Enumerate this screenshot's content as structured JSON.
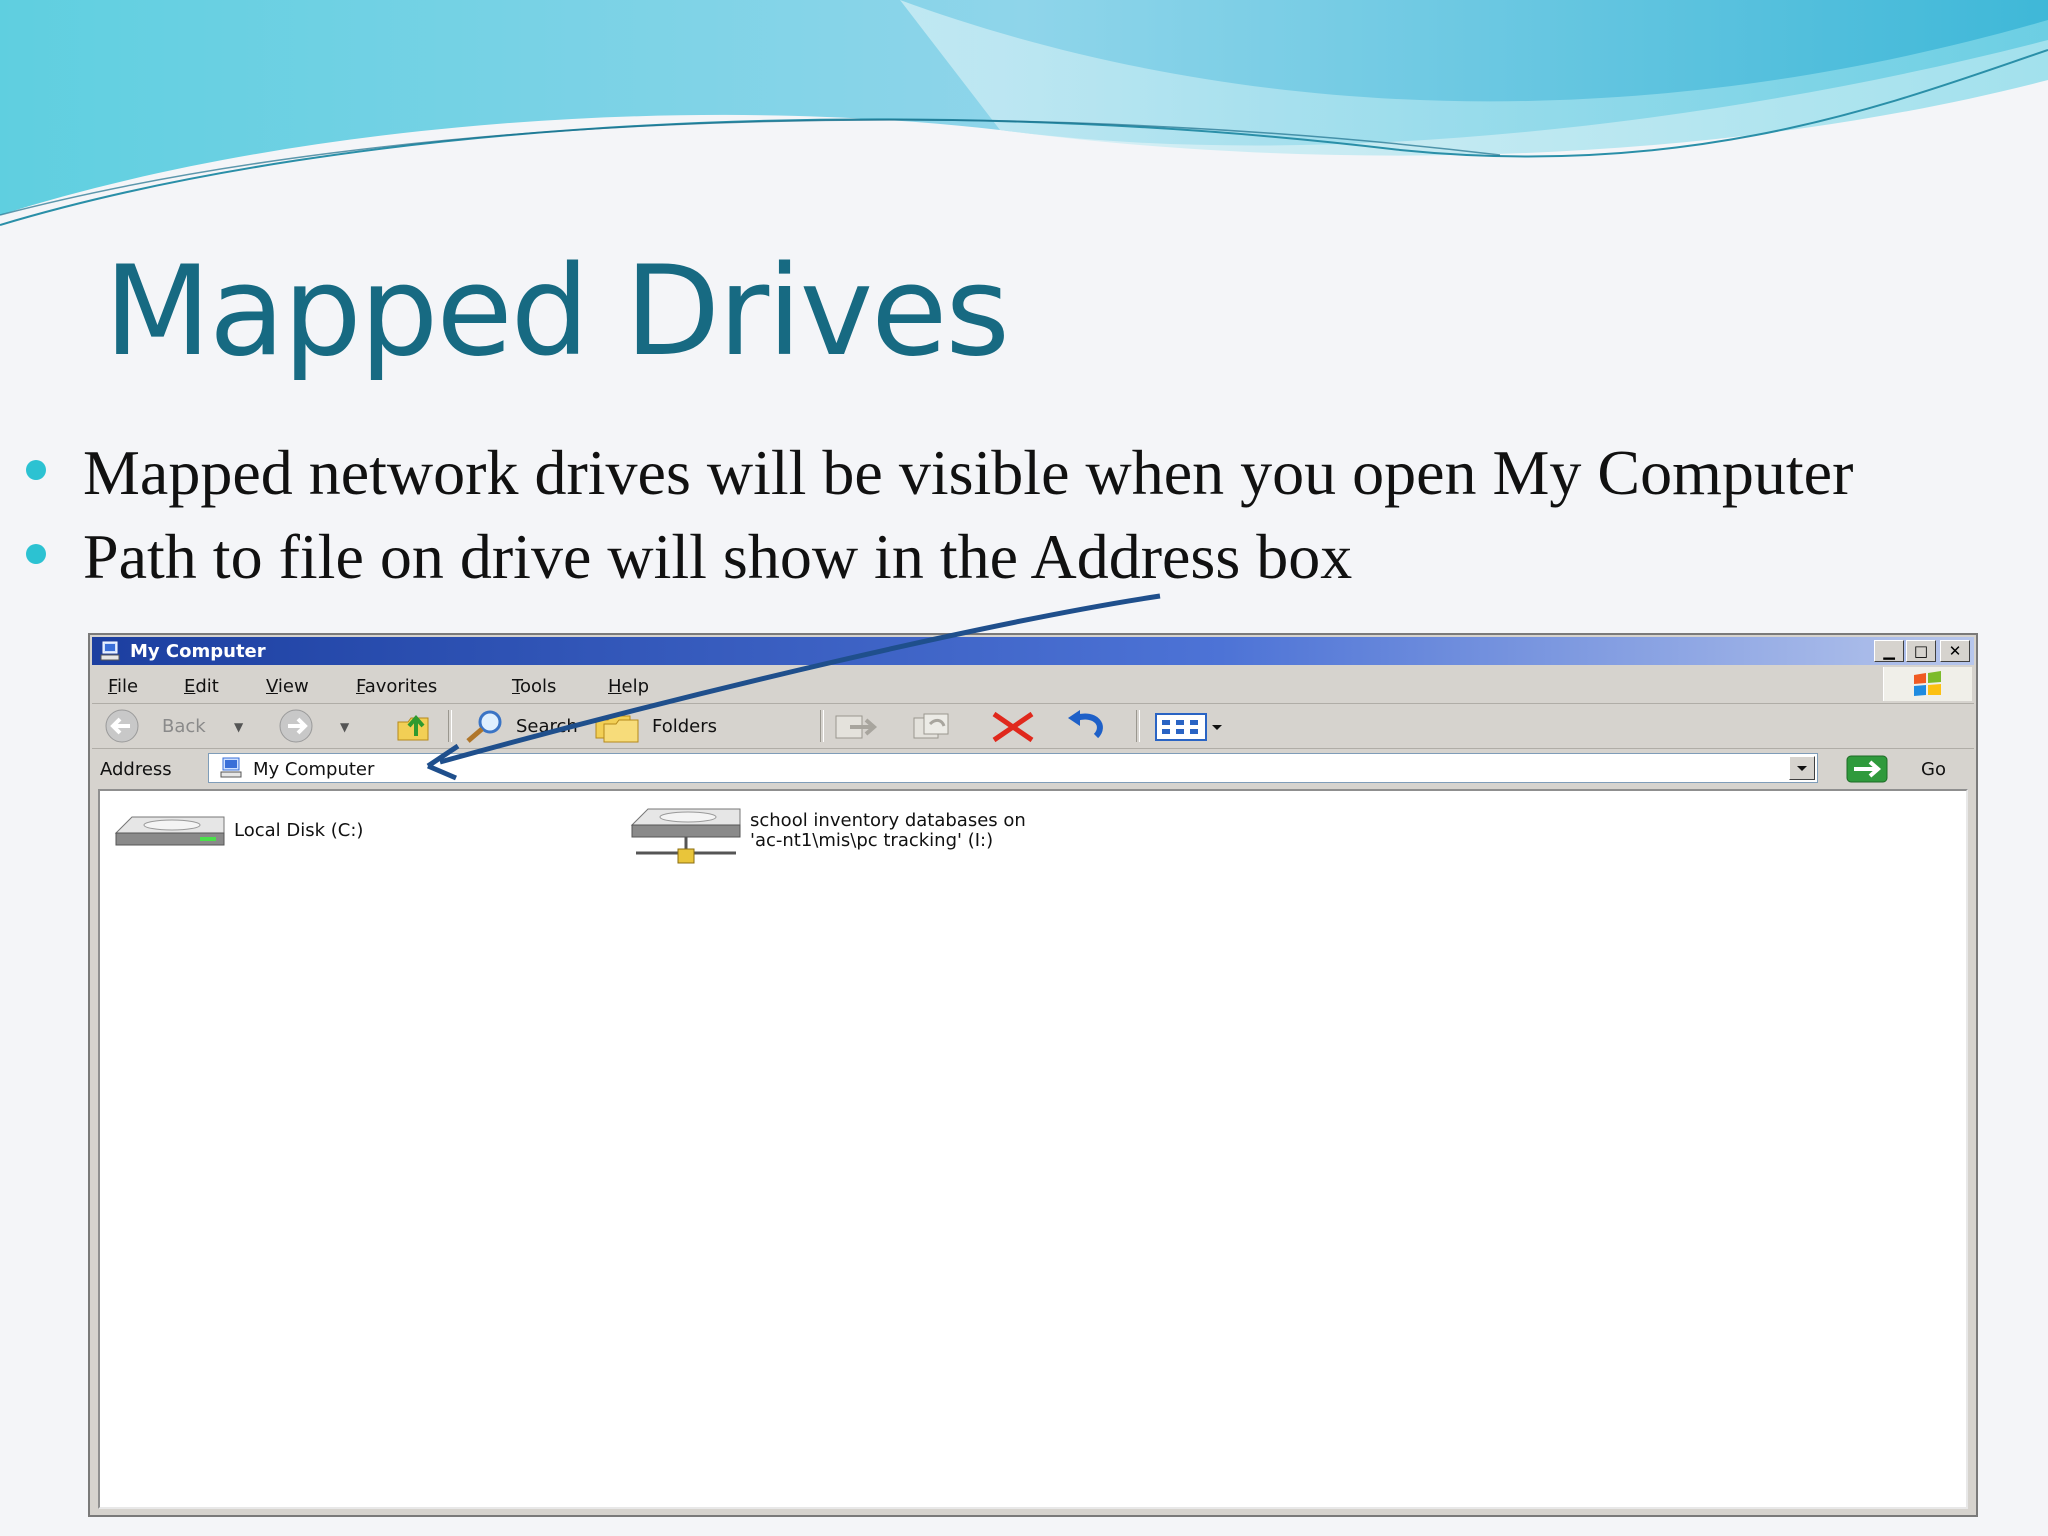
{
  "slide": {
    "title": "Mapped Drives",
    "bullets": [
      "Mapped network drives will be visible when you open My Computer",
      "Path to file on drive will show in the Address box"
    ]
  },
  "window": {
    "title": "My Computer",
    "controls": [
      "minimize",
      "maximize",
      "close"
    ],
    "menu": [
      "File",
      "Edit",
      "View",
      "Favorites",
      "Tools",
      "Help"
    ],
    "toolbar": {
      "back": "Back",
      "search": "Search",
      "folders": "Folders"
    },
    "address": {
      "label": "Address",
      "value": "My Computer",
      "go": "Go"
    },
    "drives": [
      {
        "label": "Local Disk (C:)",
        "icon": "hard-drive-icon"
      },
      {
        "label_line1": "school inventory databases on",
        "label_line2": "'ac-nt1\\mis\\pc tracking' (I:)",
        "icon": "network-drive-icon"
      }
    ]
  },
  "colors": {
    "title": "#176a82",
    "bullet": "#2cc2d2",
    "arrow": "#1f4f8c",
    "titlebar": "#1c3fa0"
  }
}
